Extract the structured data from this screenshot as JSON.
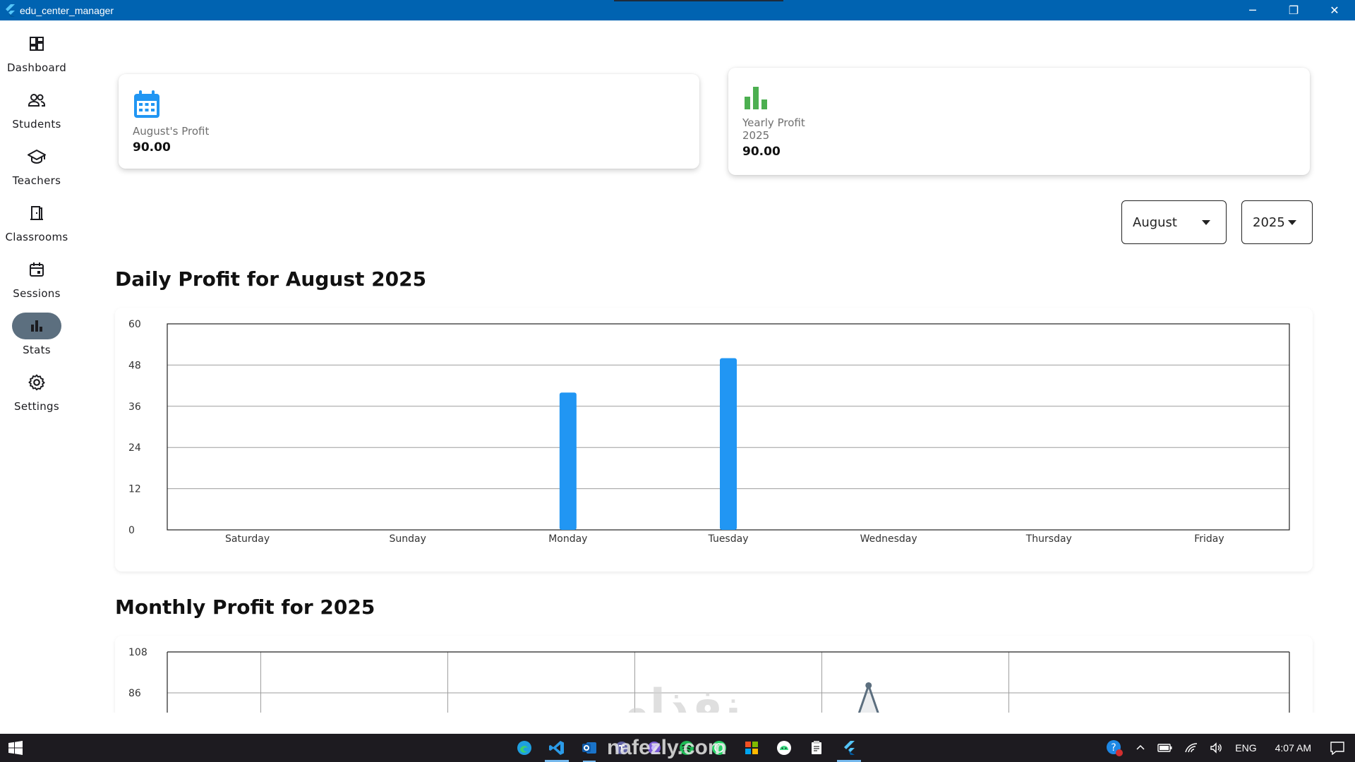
{
  "window": {
    "title": "edu_center_manager",
    "controls": {
      "minimize": "─",
      "restore": "❐",
      "close": "✕"
    }
  },
  "sidebar": {
    "items": [
      {
        "label": "Dashboard",
        "icon": "dashboard-icon",
        "active": false
      },
      {
        "label": "Students",
        "icon": "people-icon",
        "active": false
      },
      {
        "label": "Teachers",
        "icon": "school-icon",
        "active": false
      },
      {
        "label": "Classrooms",
        "icon": "door-icon",
        "active": false
      },
      {
        "label": "Sessions",
        "icon": "calendar-icon",
        "active": false
      },
      {
        "label": "Stats",
        "icon": "bar-chart-icon",
        "active": true
      },
      {
        "label": "Settings",
        "icon": "gear-icon",
        "active": false
      }
    ]
  },
  "cards": {
    "monthly": {
      "label": "August's Profit",
      "value": "90.00",
      "icon": "calendar-icon",
      "icon_color": "#2196f3"
    },
    "yearly": {
      "label": "Yearly Profit",
      "year": "2025",
      "value": "90.00",
      "icon": "bar-chart-icon",
      "icon_color": "#4caf50"
    }
  },
  "filters": {
    "month": "August",
    "year": "2025"
  },
  "daily_chart": {
    "title": "Daily Profit for August 2025"
  },
  "monthly_chart": {
    "title": "Monthly Profit for 2025"
  },
  "chart_data": [
    {
      "type": "bar",
      "title": "Daily Profit for August 2025",
      "categories": [
        "Saturday",
        "Sunday",
        "Monday",
        "Tuesday",
        "Wednesday",
        "Thursday",
        "Friday"
      ],
      "values": [
        0,
        0,
        40,
        50,
        0,
        0,
        0
      ],
      "yticks": [
        0,
        12,
        24,
        36,
        48,
        60
      ],
      "ylim": [
        0,
        60
      ],
      "bar_color": "#2196f3",
      "grid": "horizontal"
    },
    {
      "type": "line",
      "title": "Monthly Profit for 2025",
      "yticks": [
        86,
        108
      ],
      "ylim": [
        0,
        108
      ],
      "grid": "both",
      "line_color": "#5c6f7f",
      "points": [
        {
          "x": 8,
          "y": 90
        }
      ]
    }
  ],
  "taskbar": {
    "apps": [
      "edge-icon",
      "vscode-icon",
      "outlook-icon",
      "teams-icon",
      "browser-icon",
      "spotify-icon",
      "whatsapp-icon",
      "windows-store-icon",
      "android-studio-icon",
      "notepad-icon",
      "flutter-icon"
    ],
    "tray": {
      "language": "ENG",
      "time": "4:07 AM"
    }
  },
  "watermark": {
    "text_arabic": "نفذلي",
    "text_latin": "nafezly.com"
  }
}
